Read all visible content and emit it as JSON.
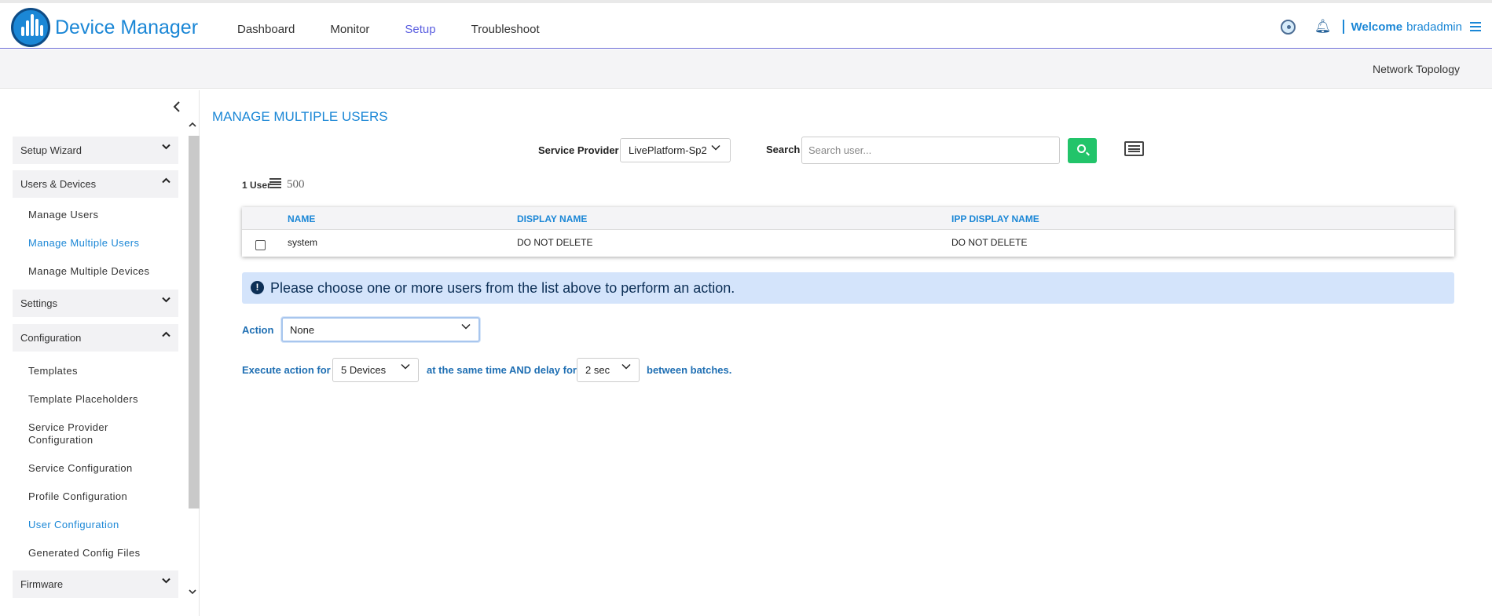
{
  "header": {
    "brand": "Device Manager",
    "nav": [
      "Dashboard",
      "Monitor",
      "Setup",
      "Troubleshoot"
    ],
    "active_nav": "Setup",
    "welcome": "Welcome",
    "username": "bradadmin",
    "icons": [
      "globe-icon",
      "bell-icon",
      "menu-icon"
    ]
  },
  "subbar": {
    "link": "Network Topology"
  },
  "sidebar": {
    "sections": [
      {
        "label": "Setup Wizard",
        "expanded": false
      },
      {
        "label": "Users & Devices",
        "expanded": true,
        "items": [
          "Manage Users",
          "Manage Multiple Users",
          "Manage Multiple Devices"
        ]
      },
      {
        "label": "Settings",
        "expanded": false
      },
      {
        "label": "Configuration",
        "expanded": true,
        "items": [
          "Templates",
          "Template Placeholders",
          "Service Provider Configuration",
          "Service Configuration",
          "Profile Configuration",
          "User Configuration",
          "Generated Config Files"
        ]
      },
      {
        "label": "Firmware",
        "expanded": false
      }
    ],
    "active_items": [
      "Manage Multiple Users",
      "User Configuration"
    ]
  },
  "main": {
    "title": "MANAGE MULTIPLE USERS",
    "service_provider_label": "Service Provider",
    "service_provider_value": "LivePlatform-Sp2",
    "search_label": "Search",
    "search_placeholder": "Search user...",
    "count_label": "1 User",
    "page_size": "500",
    "table": {
      "columns": [
        "NAME",
        "DISPLAY NAME",
        "IPP DISPLAY NAME"
      ],
      "rows": [
        {
          "name": "system",
          "display_name": "DO NOT DELETE",
          "ipp_display_name": "DO NOT DELETE"
        }
      ]
    },
    "alert": "Please choose one or more users from the list above to perform an action.",
    "action_label": "Action",
    "action_value": "None",
    "execute": {
      "prefix": "Execute action for",
      "devices_value": "5 Devices",
      "middle": "at the same time AND delay for",
      "delay_value": "2 sec",
      "suffix": "between batches."
    }
  },
  "colors": {
    "accent": "#1b87d6",
    "search_button": "#22c46a",
    "alert_bg": "#d4e4fb",
    "nav_active": "#5a5ee0"
  }
}
